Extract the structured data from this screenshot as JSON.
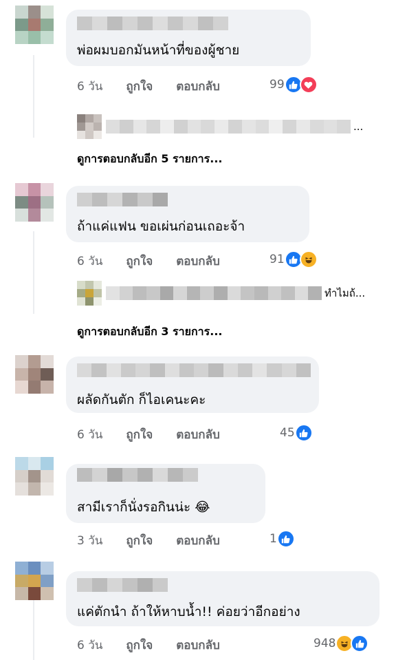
{
  "comments": [
    {
      "text": "พ่อผมบอกมันหน้าที่ของผู้ชาย",
      "time": "6 วัน",
      "like_label": "ถูกใจ",
      "reply_label": "ตอบกลับ",
      "reaction_count": "99",
      "reactions": [
        "like-icon",
        "love-icon"
      ],
      "replies_preview_tail": "...",
      "more_replies": "ดูการตอบกลับอีก 5 รายการ..."
    },
    {
      "text": "ถ้าแค่แฟน ขอเผ่นก่อนเถอะจ้า",
      "time": "6 วัน",
      "like_label": "ถูกใจ",
      "reply_label": "ตอบกลับ",
      "reaction_count": "91",
      "reactions": [
        "like-icon",
        "haha-icon"
      ],
      "replies_preview_tail": "ทำไมถ้...",
      "more_replies": "ดูการตอบกลับอีก 3 รายการ..."
    },
    {
      "text": "ผลัดกันตัก ก็ไอเคนะคะ",
      "time": "6 วัน",
      "like_label": "ถูกใจ",
      "reply_label": "ตอบกลับ",
      "reaction_count": "45",
      "reactions": [
        "like-icon"
      ]
    },
    {
      "text": "สามีเราก็นั่งรอกินน่ะ 😂",
      "time": "3 วัน",
      "like_label": "ถูกใจ",
      "reply_label": "ตอบกลับ",
      "reaction_count": "1",
      "reactions": [
        "like-icon"
      ]
    },
    {
      "text": "แค่ตักนำ  ถ้าให้หาบน้ำ!! ค่อยว่าอีกอย่าง",
      "time": "6 วัน",
      "like_label": "ถูกใจ",
      "reply_label": "ตอบกลับ",
      "reaction_count": "948",
      "reactions": [
        "haha-icon",
        "like-icon"
      ]
    }
  ],
  "colors": {
    "bubble": "#f0f2f5",
    "meta_text": "#65676b",
    "like_blue": "#1877f2",
    "love_red": "#f33e58",
    "haha_yellow": "#f7b125"
  }
}
